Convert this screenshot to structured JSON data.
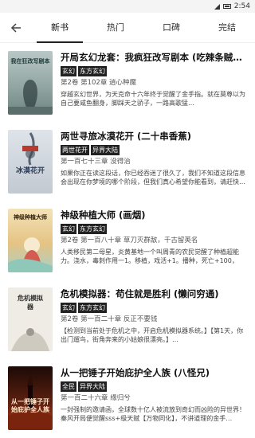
{
  "status_bar": {
    "time": "2:54"
  },
  "tabs": [
    {
      "label": "新书"
    },
    {
      "label": "热门"
    },
    {
      "label": "口碑"
    },
    {
      "label": "完结"
    }
  ],
  "books": [
    {
      "title": "开局玄幻龙套：我疯狂改写剧本 (吃辣条贼…",
      "tags": [
        "玄幻",
        "东方玄幻"
      ],
      "chapter": "第2卷 第102章 逍心种魔",
      "desc": "穿越玄幻世界，为天克命十六年终于觉醒了金手指。就在莫尊以为自己要咸鱼翻身，脚踩天之骄子，一路高歌猛…",
      "cover_text": "我在狂改写剧本",
      "cover_bg": "#9fb2b0"
    },
    {
      "title": "两世寻旅冰漠花开 (二十串香蕉)",
      "tags": [
        "两世花开",
        "异界大陆"
      ],
      "chapter": "第一百七十三章 没得治",
      "desc": "如果你正在读这段话，你已经吞迷了很久了，我们不知道这段信息会出现在你梦境的哪个阶段，但我们真心希望你能看到，请赶快…",
      "cover_text": "冰漠花开",
      "cover_bg": "#c9ced4"
    },
    {
      "title": "神级种植大师 (画烟)",
      "tags": [
        "玄幻",
        "东方玄幻"
      ],
      "chapter": "第2卷 第一百八十章 草刀灭群敌，千古留英名",
      "desc": "人类移民第二母星，炎黄基地一个叫周青的农民觉醒了种植超能力。浇水，毒刺作用一1。移植，戏活+1。播种，死亡+100，变…",
      "cover_text": "神级种植大师",
      "cover_bg": "#e8c98a"
    },
    {
      "title": "危机模拟器：苟住就是胜利 (懒问穷通)",
      "tags": [
        "玄幻",
        "东方玄幻"
      ],
      "chapter": "第2卷 第一百二十章 反正不要钱",
      "desc": "【检测到当前处于危机之中，开启危机模拟器系统。】【第1天，你出门遛鸟，街角奔来的小姑娘很漂亮。】…",
      "cover_text": "危机模拟器",
      "cover_bg": "#ece9e2"
    },
    {
      "title": "从一把锤子开始庇护全人族 (八怪兄)",
      "tags": [
        "全民",
        "异界大陆"
      ],
      "chapter": "第一百二十六章 缘归兮",
      "desc": "一封强制的邀请函，全球数十亿人被流放到奇幻而凶险的异世界！秦风开局便觉醒sss+级天赋【万物同化】，不讲道理的金手…",
      "cover_text": "从一把锤子开始庇护全人族",
      "cover_bg": "#3a1810"
    }
  ]
}
